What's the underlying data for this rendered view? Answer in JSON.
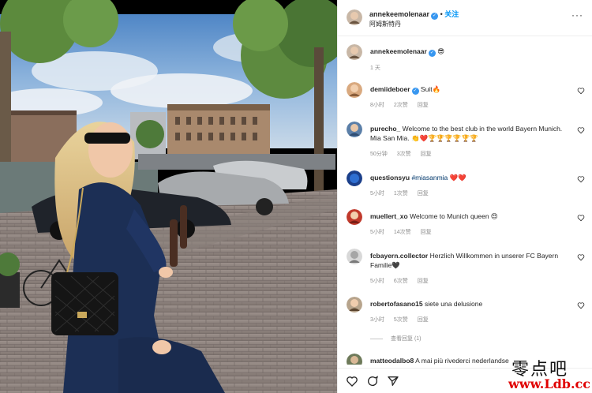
{
  "post": {
    "author": "annekeemolenaar",
    "follow_separator": "•",
    "follow_label": "关注",
    "location": "阿姆斯特丹",
    "more": "···"
  },
  "caption": {
    "author": "annekeemolenaar",
    "text": "😎",
    "time": "1 天"
  },
  "comments": [
    {
      "user": "demiideboer",
      "verified": true,
      "text": "Suit🔥",
      "time": "8小时",
      "likes": "2次赞",
      "reply": "回复"
    },
    {
      "user": "purecho_",
      "verified": false,
      "text": "Welcome to the best club in the world Bayern Munich. Mia San Mia. 👏❤️🏆🏆🏆🏆🏆🏆",
      "time": "50分钟",
      "likes": "3次赞",
      "reply": "回复"
    },
    {
      "user": "questionsyu",
      "verified": false,
      "text": "#miasanmia ❤️❤️",
      "time": "5小时",
      "likes": "1次赞",
      "reply": "回复"
    },
    {
      "user": "muellert_xo",
      "verified": false,
      "text": "Welcome to Munich queen 😍",
      "time": "5小时",
      "likes": "14次赞",
      "reply": "回复"
    },
    {
      "user": "fcbayern.collector",
      "verified": false,
      "text": "Herzlich Willkommen in unserer FC Bayern Familie🖤",
      "time": "5小时",
      "likes": "6次赞",
      "reply": "回复"
    },
    {
      "user": "robertofasano15",
      "verified": false,
      "text": "siete una delusione",
      "time": "3小时",
      "likes": "5次赞",
      "reply": "回复"
    },
    {
      "user": "matteodalbo8",
      "verified": false,
      "text": "A mai più rivederci nederlandse",
      "time": "",
      "likes": "",
      "reply": ""
    }
  ],
  "view_replies": "查看回复 (1)",
  "icons": {
    "like": "heart-icon",
    "comment": "comment-icon",
    "share": "share-icon",
    "comment_like": "heart-icon"
  },
  "watermark": {
    "line1": "零点吧",
    "line2": "www.Ldb.cc"
  },
  "colors": {
    "verified": "#3897f0",
    "follow": "#0095f6",
    "meta": "#8e8e8e",
    "watermark_red": "#e00000"
  }
}
